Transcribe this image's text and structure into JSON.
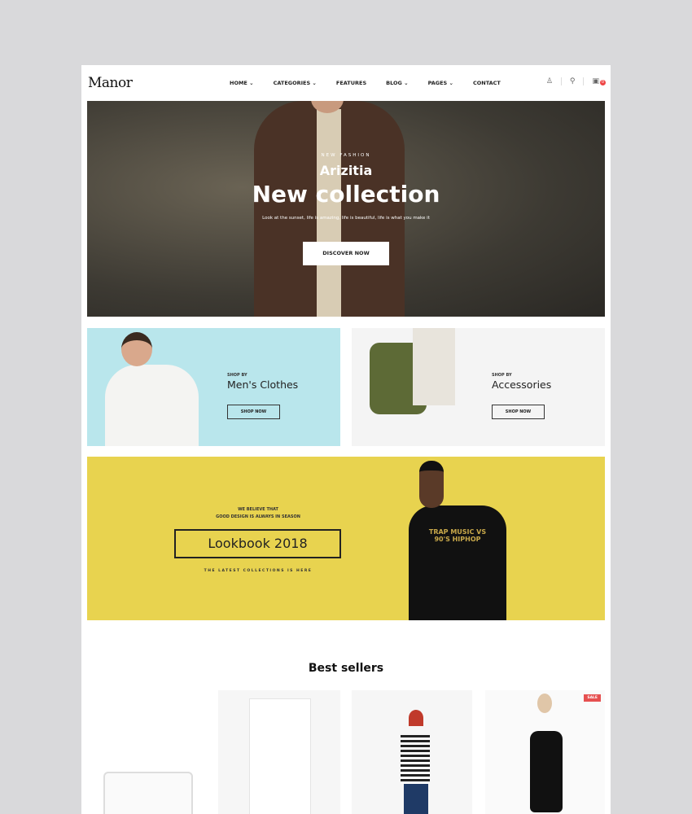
{
  "header": {
    "logo": "Manor",
    "nav": [
      "HOME ⌄",
      "CATEGORIES ⌄",
      "FEATURES",
      "BLOG ⌄",
      "PAGES ⌄",
      "CONTACT"
    ],
    "cart_count": "0"
  },
  "hero": {
    "eyebrow": "NEW FASHION",
    "subtitle": "Arizitia",
    "title": "New collection",
    "text": "Look at the sunset, life is amazing, life is beautiful, life is what you make it",
    "button": "DISCOVER NOW"
  },
  "banners": [
    {
      "eyebrow": "SHOP BY",
      "title": "Men's Clothes",
      "button": "SHOP NOW"
    },
    {
      "eyebrow": "SHOP BY",
      "title": "Accessories",
      "button": "SHOP NOW"
    }
  ],
  "lookbook": {
    "line1": "WE BELIEVE THAT",
    "line2": "GOOD DESIGN IS ALWAYS IN SEASON",
    "title": "Lookbook 2018",
    "tagline": "THE LATEST COLLECTIONS IS HERE",
    "shirt_text": "TRAP MUSIC VS 90'S HIPHOP"
  },
  "best_sellers": {
    "title": "Best sellers",
    "sale_badge": "SALE"
  }
}
